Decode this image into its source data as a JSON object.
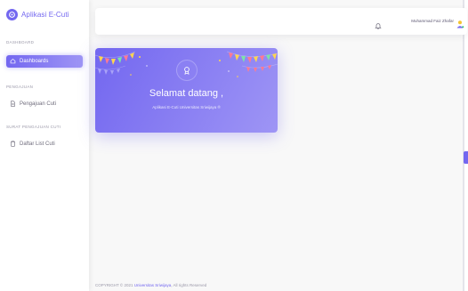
{
  "sidebar": {
    "app_name": "Aplikasi E-Cuti",
    "sections": [
      {
        "label": "DASHBOARD",
        "items": [
          {
            "label": "Dashboards",
            "icon": "home-icon",
            "active": true
          }
        ]
      },
      {
        "label": "PENGAJUAN",
        "items": [
          {
            "label": "Pengajuan Cuti",
            "icon": "file-icon",
            "active": false
          }
        ]
      },
      {
        "label": "SURAT PENGAJUAN CUTI",
        "items": [
          {
            "label": "Daftar List Cuti",
            "icon": "clipboard-icon",
            "active": false
          }
        ]
      }
    ]
  },
  "topbar": {
    "user_name": "Muhammad Faiz Zhafar",
    "notification_icon": "bell-icon",
    "avatar_icon": "avatar-icon"
  },
  "welcome_card": {
    "title": "Selamat datang ,",
    "subtitle": "Aplikasi E-Cuti Universitas Sriwijaya ®",
    "icon": "award-icon",
    "accent": "#7367f0"
  },
  "footer": {
    "text": "COPYRIGHT © 2021 ",
    "link": "Universitas Sriwijaya",
    "suffix": ", All rights Reserved"
  }
}
